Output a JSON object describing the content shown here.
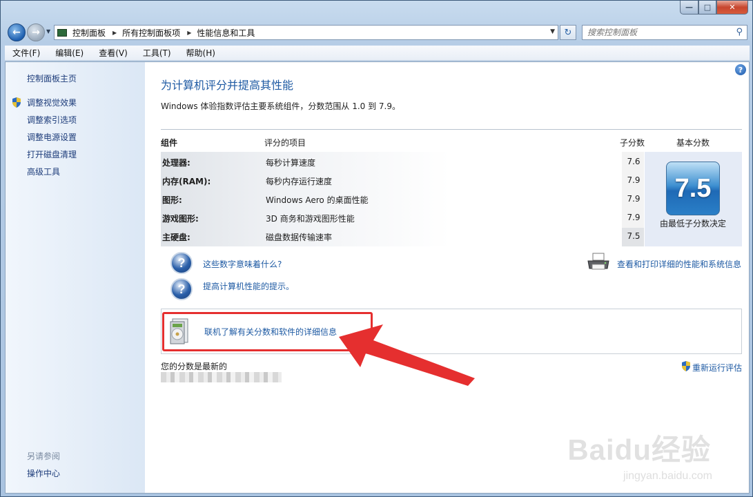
{
  "titlebar": {
    "minimize_icon": "minimize-icon",
    "maximize_icon": "maximize-icon",
    "close_icon": "close-icon"
  },
  "address": {
    "crumbs": [
      "控制面板",
      "所有控制面板项",
      "性能信息和工具"
    ]
  },
  "search": {
    "placeholder": "搜索控制面板"
  },
  "menu": {
    "items": [
      "文件(F)",
      "编辑(E)",
      "查看(V)",
      "工具(T)",
      "帮助(H)"
    ]
  },
  "sidebar": {
    "home": "控制面板主页",
    "links": [
      "调整视觉效果",
      "调整索引选项",
      "调整电源设置",
      "打开磁盘清理",
      "高级工具"
    ],
    "see_also": "另请参阅",
    "action_center": "操作中心"
  },
  "main": {
    "title": "为计算机评分并提高其性能",
    "description": "Windows 体验指数评估主要系统组件，分数范围从 1.0 到 7.9。",
    "headers": {
      "component": "组件",
      "item": "评分的项目",
      "subscore": "子分数",
      "base": "基本分数"
    },
    "rows": [
      {
        "component": "处理器:",
        "item": "每秒计算速度",
        "score": "7.6"
      },
      {
        "component": "内存(RAM):",
        "item": "每秒内存运行速度",
        "score": "7.9"
      },
      {
        "component": "图形:",
        "item": "Windows Aero 的桌面性能",
        "score": "7.9"
      },
      {
        "component": "游戏图形:",
        "item": "3D 商务和游戏图形性能",
        "score": "7.9"
      },
      {
        "component": "主硬盘:",
        "item": "磁盘数据传输速率",
        "score": "7.5"
      }
    ],
    "base_score": "7.5",
    "base_caption": "由最低子分数决定",
    "link_meaning": "这些数字意味着什么?",
    "link_tips": "提高计算机性能的提示。",
    "link_print": "查看和打印详细的性能和系统信息",
    "link_online": "联机了解有关分数和软件的详细信息",
    "status": "您的分数是最新的",
    "rerun": "重新运行评估"
  },
  "accent": {
    "link": "#1e5aa3",
    "highlight": "#e52f2f"
  },
  "watermark": {
    "brand": "Baidu经验",
    "url": "jingyan.baidu.com"
  }
}
